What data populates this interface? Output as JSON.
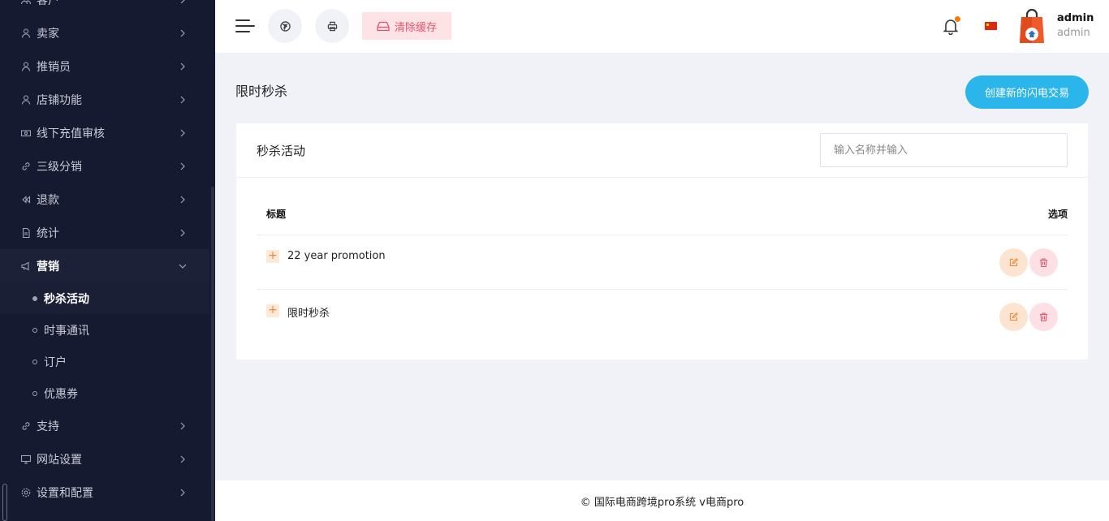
{
  "sidebar": {
    "items_top": [
      {
        "label": "客户",
        "icon": "people-icon"
      },
      {
        "label": "卖家",
        "icon": "user-icon"
      },
      {
        "label": "推销员",
        "icon": "user-icon"
      },
      {
        "label": "店铺功能",
        "icon": "user-icon"
      },
      {
        "label": "线下充值审核",
        "icon": "cash-icon"
      },
      {
        "label": "三级分销",
        "icon": "link-icon"
      },
      {
        "label": "退款",
        "icon": "rewind-icon"
      },
      {
        "label": "统计",
        "icon": "file-icon"
      },
      {
        "label": "营销",
        "icon": "megaphone-icon"
      }
    ],
    "marketing_sub": [
      {
        "label": "秒杀活动"
      },
      {
        "label": "时事通讯"
      },
      {
        "label": "订户"
      },
      {
        "label": "优惠券"
      }
    ],
    "items_bottom": [
      {
        "label": "支持",
        "icon": "link-icon"
      },
      {
        "label": "网站设置",
        "icon": "monitor-icon"
      },
      {
        "label": "设置和配置",
        "icon": "gear-icon"
      }
    ]
  },
  "topbar": {
    "clear_cache_label": "清除缓存",
    "user_name": "admin",
    "user_role": "admin",
    "language_flag": "cn-flag"
  },
  "main": {
    "page_title": "限时秒杀",
    "create_button": "创建新的闪电交易",
    "card_title": "秒杀活动",
    "search_placeholder": "输入名称并输入",
    "columns": {
      "title": "标题",
      "options": "选项"
    },
    "rows": [
      {
        "title": "22 year promotion"
      },
      {
        "title": "限时秒杀"
      }
    ]
  },
  "footer": {
    "text": "© 国际电商跨境pro系统 v电商pro"
  },
  "colors": {
    "sidebar_bg": "#151a30",
    "accent": "#2ab6ea",
    "clear_cache_text": "#e0566e",
    "edit": "#f08a3b",
    "delete": "#e0566e"
  }
}
